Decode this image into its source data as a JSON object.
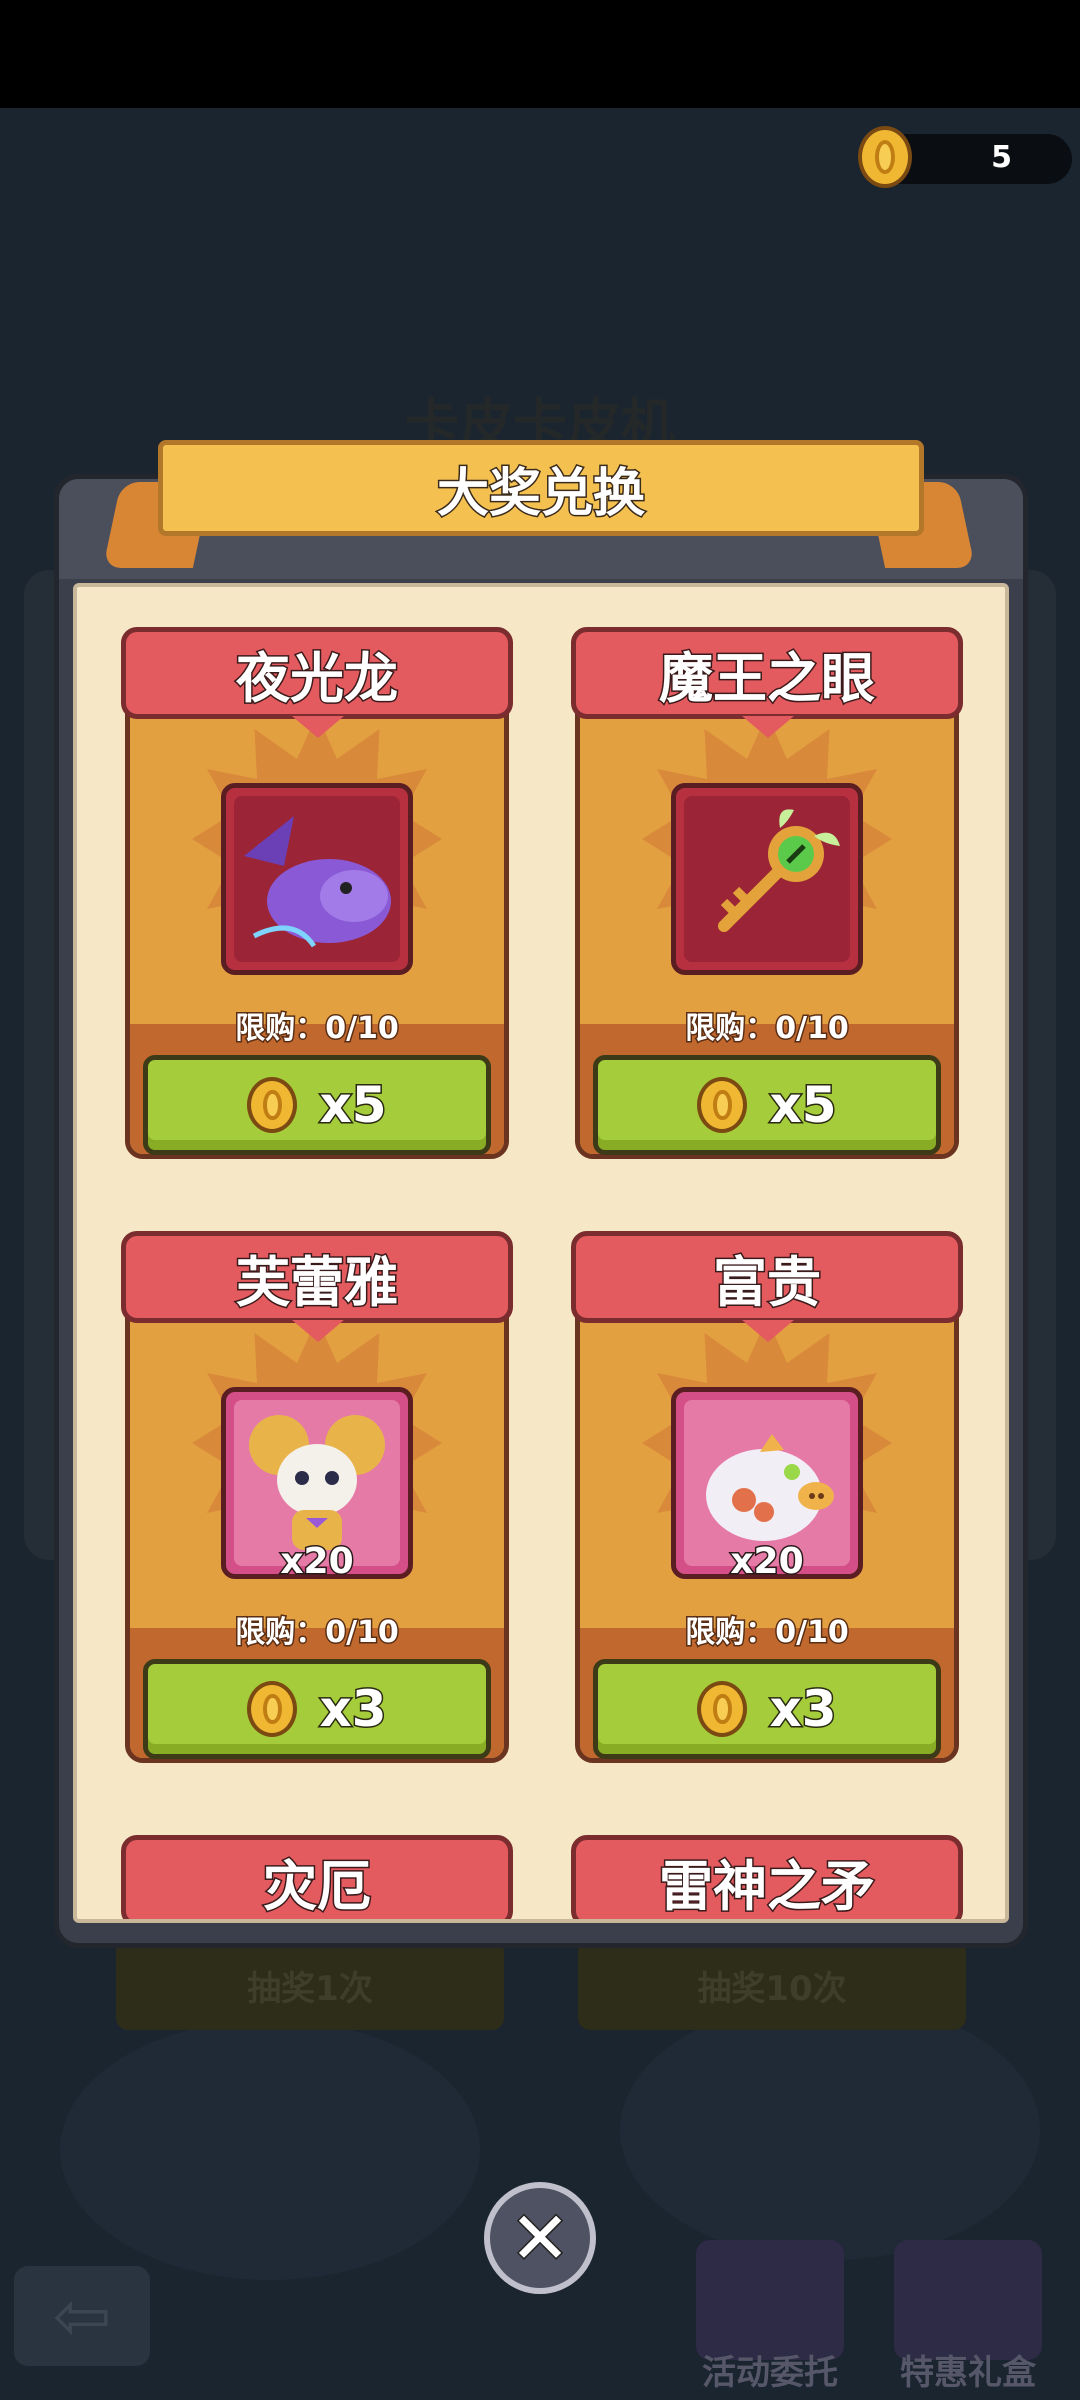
{
  "status": {
    "coin_count": "5"
  },
  "background": {
    "title": "卡皮卡皮机",
    "draw_once": "抽奖1次",
    "draw_ten": "抽奖10次",
    "event_label": "活动委托",
    "gift_label": "特惠礼盒"
  },
  "dialog": {
    "title": "大奖兑换",
    "cards": [
      {
        "name": "夜光龙",
        "limit": "限购：0/10",
        "price": "x5",
        "qty": "",
        "icon": "purple-dragon-icon"
      },
      {
        "name": "魔王之眼",
        "limit": "限购：0/10",
        "price": "x5",
        "qty": "",
        "icon": "eye-key-icon"
      },
      {
        "name": "芙蕾雅",
        "limit": "限购：0/10",
        "price": "x3",
        "qty": "x20",
        "icon": "mouse-pet-icon"
      },
      {
        "name": "富贵",
        "limit": "限购：0/10",
        "price": "x3",
        "qty": "x20",
        "icon": "piggy-pet-icon"
      },
      {
        "name": "灾厄"
      },
      {
        "name": "雷神之矛"
      }
    ]
  },
  "colors": {
    "card_header": "#e35a5f",
    "price_button": "#a5cc3a",
    "banner": "#f4c151"
  }
}
